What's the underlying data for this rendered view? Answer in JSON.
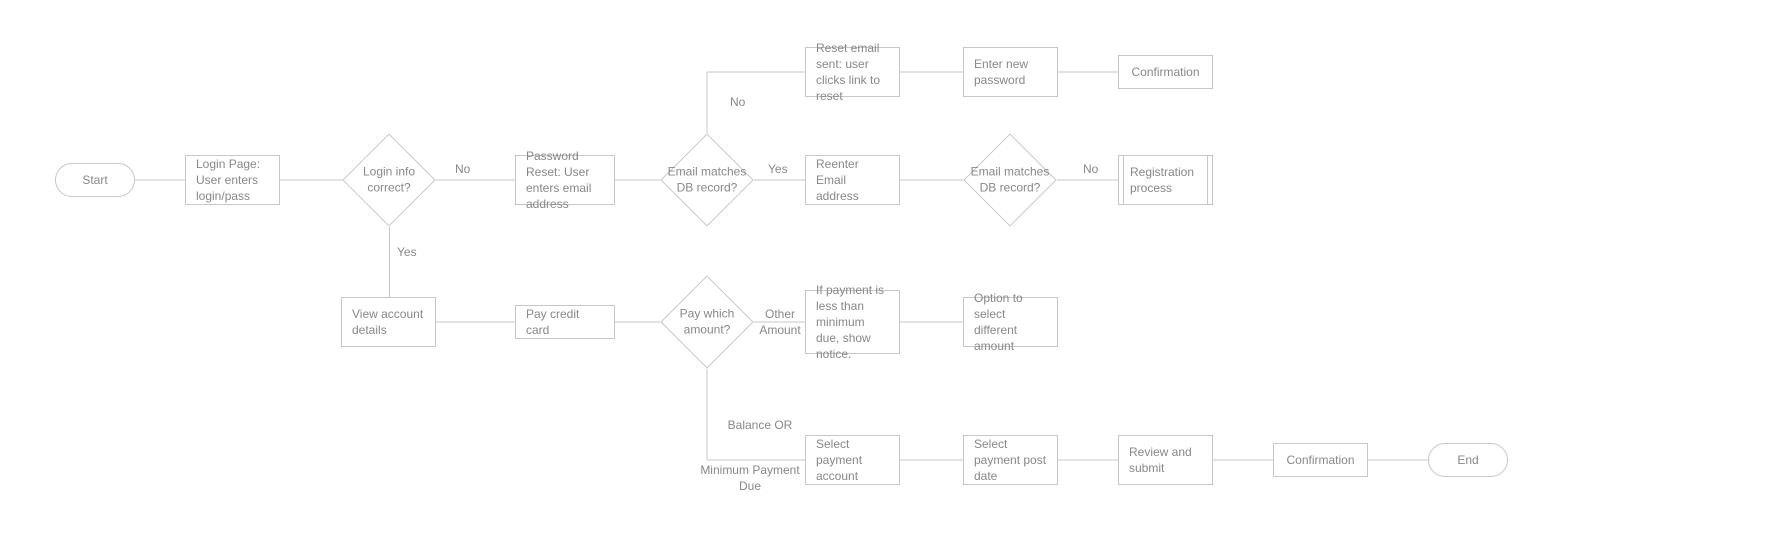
{
  "nodes": {
    "start": "Start",
    "login_page": "Login Page: User enters login/pass",
    "login_correct": "Login info correct?",
    "password_reset": "Password Reset: User enters email address",
    "email_match1": "Email matches DB record?",
    "reset_email_sent": "Reset email sent: user clicks link to reset",
    "enter_new_password": "Enter new password",
    "confirmation_pw": "Confirmation",
    "reenter_email": "Reenter Email address",
    "email_match2": "Email matches DB record?",
    "registration_process": "Registration process",
    "view_account": "View account details",
    "pay_credit_card": "Pay credit card",
    "pay_which_amount": "Pay which amount?",
    "payment_notice": "If payment is less than minimum due, show notice.",
    "option_different": "Option to select different amount",
    "select_payment_account": "Select payment account",
    "select_post_date": "Select payment post date",
    "review_submit": "Review and submit",
    "confirmation_pay": "Confirmation",
    "end": "End"
  },
  "edges": {
    "login_no": "No",
    "login_yes": "Yes",
    "email1_no": "No",
    "email1_yes": "Yes",
    "email2_no": "No",
    "other_amount": "Other Amount",
    "balance_or": "Balance OR",
    "min_payment_due": "Minimum Payment Due"
  }
}
